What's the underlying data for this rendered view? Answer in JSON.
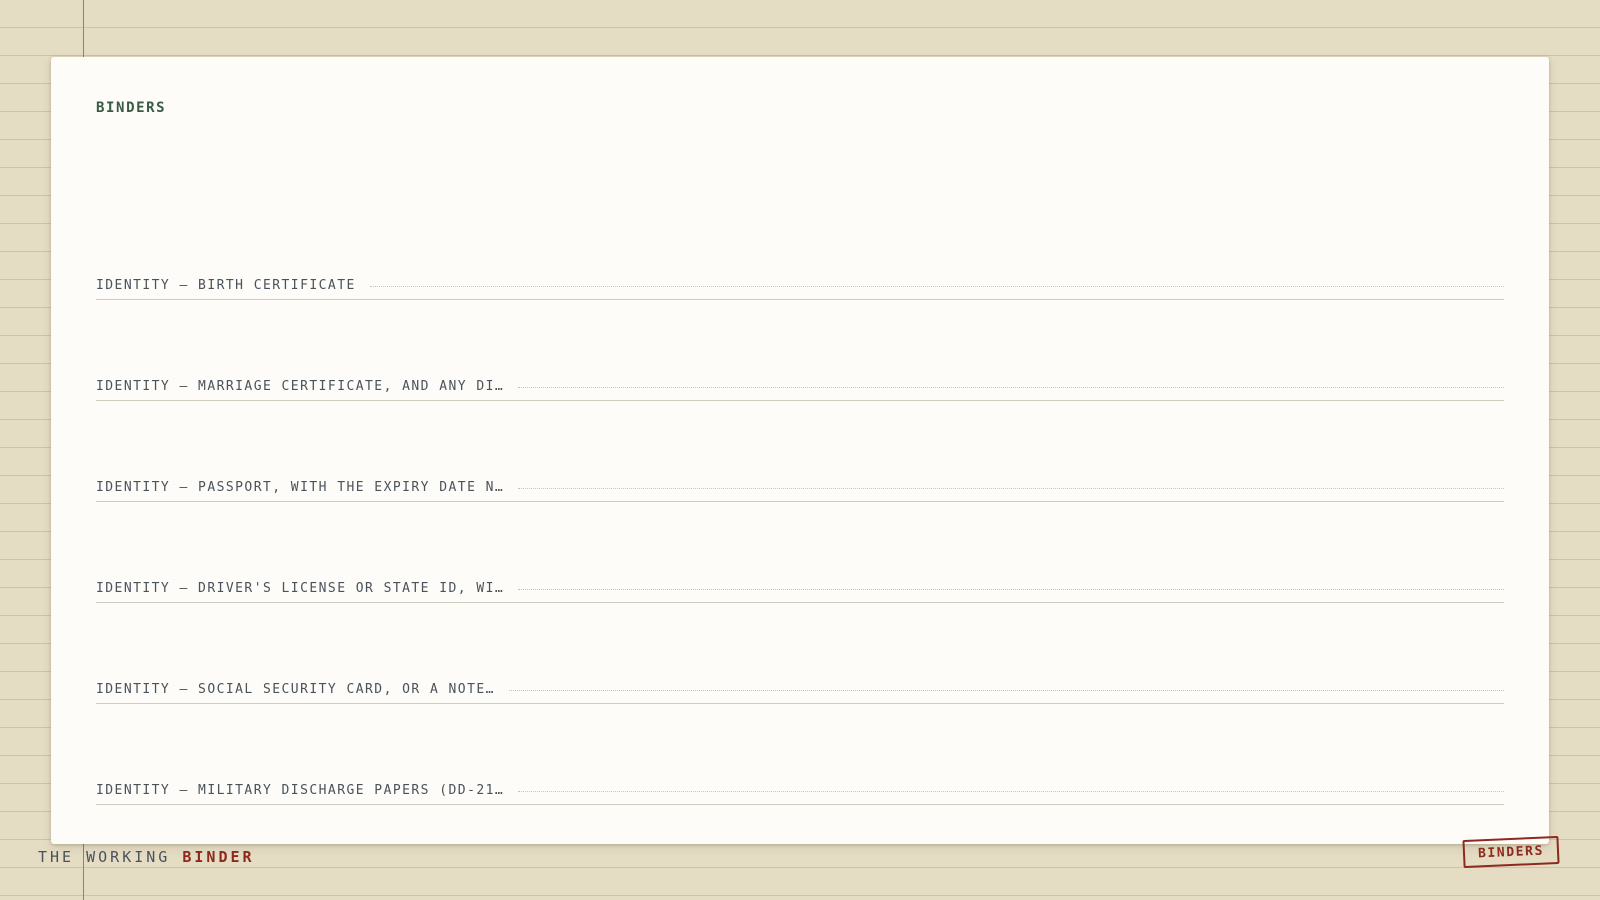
{
  "card": {
    "title": "BINDERS",
    "items": [
      {
        "label": "IDENTITY — BIRTH CERTIFICATE"
      },
      {
        "label": "IDENTITY — MARRIAGE CERTIFICATE, AND ANY DI…"
      },
      {
        "label": "IDENTITY — PASSPORT, WITH THE EXPIRY DATE N…"
      },
      {
        "label": "IDENTITY — DRIVER'S LICENSE OR STATE ID, WI…"
      },
      {
        "label": "IDENTITY — SOCIAL SECURITY CARD, OR A NOTE…"
      },
      {
        "label": "IDENTITY — MILITARY DISCHARGE PAPERS (DD-21…"
      }
    ]
  },
  "footer": {
    "brand_prefix": "THE WORKING ",
    "brand_accent": "BINDER",
    "stamp_label": "BINDERS"
  },
  "colors": {
    "background": "#e4dcc3",
    "card": "#fdfcf8",
    "title_green": "#3b5a45",
    "text": "#4a525b",
    "accent_red": "#8e2a1d",
    "margin_rule": "#c9695a"
  }
}
